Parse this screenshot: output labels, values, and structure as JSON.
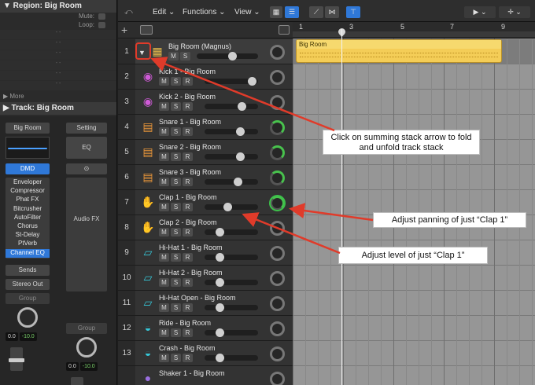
{
  "inspector": {
    "region_header": "▼ Region: Big Room",
    "mute_label": "Mute:",
    "loop_label": "Loop:",
    "dash_placeholder": "- -",
    "more_label": "▶ More",
    "track_header": "▶ Track:  Big Room",
    "strip1": {
      "name": "Big Room",
      "group_name": "DMD",
      "plugins": [
        "Enveloper",
        "Compressor",
        "Phat FX",
        "Bitcrusher",
        "AutoFilter",
        "Chorus",
        "St-Delay",
        "PtVerb",
        "Channel EQ"
      ],
      "sends": "Sends",
      "output": "Stereo Out",
      "group": "Group",
      "vol": "0.0",
      "peak": "-10.0"
    },
    "strip2": {
      "setting": "Setting",
      "eq": "EQ",
      "link_icon": "link-icon",
      "audio_fx": "Audio FX",
      "group": "Group",
      "vol": "0.0",
      "peak": "-10.0"
    }
  },
  "toolbar": {
    "edit": "Edit",
    "functions": "Functions",
    "view": "View"
  },
  "ruler": {
    "bars": [
      "1",
      "3",
      "5",
      "7",
      "9"
    ]
  },
  "region": {
    "name": "Big Room"
  },
  "tracks": [
    {
      "num": "1",
      "name": "Big Room (Magnus)",
      "icon": "drum-machine-icon",
      "buttons": [
        "M",
        "S"
      ],
      "top": true
    },
    {
      "num": "2",
      "name": "Kick 1 - Big Room",
      "icon": "kick-drum-icon",
      "buttons": [
        "M",
        "S",
        "R"
      ]
    },
    {
      "num": "3",
      "name": "Kick 2 - Big Room",
      "icon": "kick-drum-icon",
      "buttons": [
        "M",
        "S",
        "R"
      ]
    },
    {
      "num": "4",
      "name": "Snare 1 - Big Room",
      "icon": "snare-drum-icon",
      "buttons": [
        "M",
        "S",
        "R"
      ]
    },
    {
      "num": "5",
      "name": "Snare 2 - Big Room",
      "icon": "snare-drum-icon",
      "buttons": [
        "M",
        "S",
        "R"
      ]
    },
    {
      "num": "6",
      "name": "Snare 3 - Big Room",
      "icon": "snare-drum-icon",
      "buttons": [
        "M",
        "S",
        "R"
      ]
    },
    {
      "num": "7",
      "name": "Clap 1 - Big Room",
      "icon": "clap-icon",
      "buttons": [
        "M",
        "S",
        "R"
      ]
    },
    {
      "num": "8",
      "name": "Clap 2 - Big Room",
      "icon": "clap-icon",
      "buttons": [
        "M",
        "S",
        "R"
      ]
    },
    {
      "num": "9",
      "name": "Hi-Hat 1 - Big Room",
      "icon": "hihat-icon",
      "buttons": [
        "M",
        "S",
        "R"
      ]
    },
    {
      "num": "10",
      "name": "Hi-Hat 2 - Big Room",
      "icon": "hihat-icon",
      "buttons": [
        "M",
        "S",
        "R"
      ]
    },
    {
      "num": "11",
      "name": "Hi-Hat Open - Big Room",
      "icon": "hihat-icon",
      "buttons": [
        "M",
        "S",
        "R"
      ]
    },
    {
      "num": "12",
      "name": "Ride - Big Room",
      "icon": "cymbal-icon",
      "buttons": [
        "M",
        "S",
        "R"
      ]
    },
    {
      "num": "13",
      "name": "Crash - Big Room",
      "icon": "cymbal-icon",
      "buttons": [
        "M",
        "S",
        "R"
      ]
    },
    {
      "num": "",
      "name": "Shaker 1 - Big Room",
      "icon": "shaker-icon",
      "buttons": []
    }
  ],
  "annotations": {
    "fold": "Click on summing stack arrow to fold and unfold track stack",
    "pan": "Adjust panning of just “Clap 1”",
    "level": "Adjust level of just “Clap 1”"
  },
  "colors": {
    "region": "#f4cd57",
    "annotation_red": "#e03b2a",
    "pan_green": "#48c24d",
    "selection_blue": "#2f78d8"
  }
}
